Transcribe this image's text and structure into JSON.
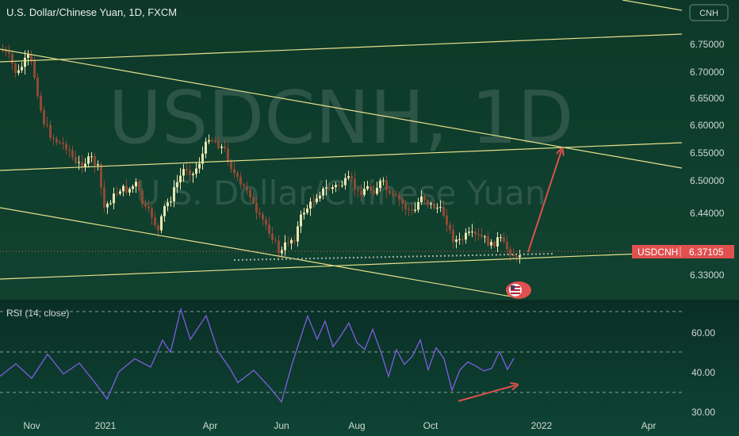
{
  "header": {
    "title": "U.S. Dollar/Chinese Yuan, 1D, FXCM",
    "currency_badge": "CNH"
  },
  "watermark": {
    "symbol": "USDCNH, 1D",
    "description": "U.S. Dollar/Chinese Yuan"
  },
  "price_axis": {
    "labels": [
      "6.75000",
      "6.70000",
      "6.65000",
      "6.60000",
      "6.55000",
      "6.50000",
      "6.44000",
      "6.33000"
    ]
  },
  "price_tag": {
    "symbol": "USDCNH",
    "value": "6.37105",
    "color": "#e0504f"
  },
  "time_axis": {
    "labels": [
      "Nov",
      "2021",
      "Apr",
      "Jun",
      "Aug",
      "Oct",
      "2022",
      "Apr"
    ]
  },
  "rsi": {
    "title": "RSI (14, close)",
    "labels": [
      "60.00",
      "40.00",
      "30.00"
    ],
    "color": "#7e5ee0"
  },
  "colors": {
    "background": "#0f3b2c",
    "candle_up": "#e8e6b0",
    "candle_down": "#8f4a34",
    "trend_line": "#e6e08a",
    "arrow": "#e0504f"
  },
  "icons": {
    "event_flag": "us-flag-icon"
  }
}
